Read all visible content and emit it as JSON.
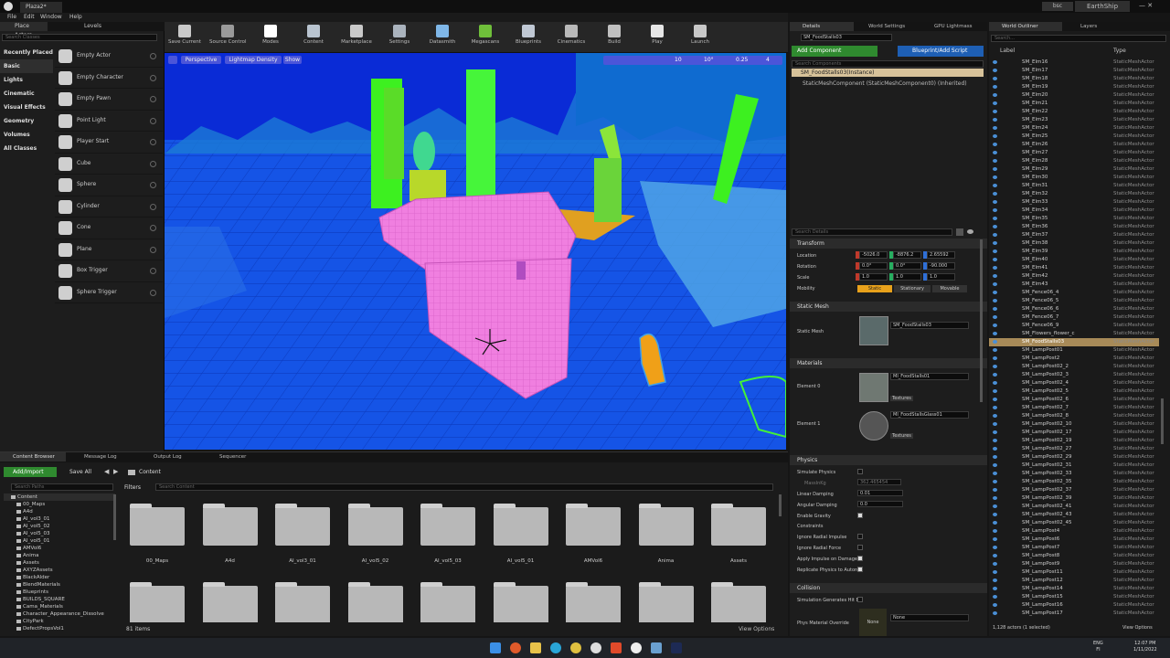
{
  "window": {
    "title": "Plaza2*",
    "right_title_1": "bsc",
    "right_title_2": "EarthShip"
  },
  "menu": [
    "File",
    "Edit",
    "Window",
    "Help"
  ],
  "toolbar": [
    {
      "label": "Save Current",
      "icon": "save-icon",
      "color": "#c9c9c9"
    },
    {
      "label": "Source Control",
      "icon": "source-control-icon",
      "color": "#9a9a9a"
    },
    {
      "label": "Modes",
      "icon": "modes-icon",
      "color": "#ffffff"
    },
    {
      "label": "Content",
      "icon": "content-icon",
      "color": "#b9c4d0"
    },
    {
      "label": "Marketplace",
      "icon": "marketplace-icon",
      "color": "#c9c9c9"
    },
    {
      "label": "Settings",
      "icon": "settings-icon",
      "color": "#aab3bd"
    },
    {
      "label": "Datasmith",
      "icon": "datasmith-icon",
      "color": "#7fb7e8"
    },
    {
      "label": "Megascans",
      "icon": "megascans-icon",
      "color": "#6fbf3a"
    },
    {
      "label": "Blueprints",
      "icon": "blueprints-icon",
      "color": "#c0c8d4"
    },
    {
      "label": "Cinematics",
      "icon": "cinematics-icon",
      "color": "#b9b9b9"
    },
    {
      "label": "Build",
      "icon": "build-icon",
      "color": "#c0c0c0"
    },
    {
      "label": "Play",
      "icon": "play-icon",
      "color": "#e6e6e6"
    },
    {
      "label": "Launch",
      "icon": "launch-icon",
      "color": "#c8c8c8"
    }
  ],
  "modes": {
    "tabs": [
      "Place Actors",
      "Levels"
    ],
    "search_placeholder": "Search Classes",
    "categories": [
      "Recently Placed",
      "Basic",
      "Lights",
      "Cinematic",
      "Visual Effects",
      "Geometry",
      "Volumes",
      "All Classes"
    ],
    "active_category": "Basic",
    "items": [
      "Empty Actor",
      "Empty Character",
      "Empty Pawn",
      "Point Light",
      "Player Start",
      "Cube",
      "Sphere",
      "Cylinder",
      "Cone",
      "Plane",
      "Box Trigger",
      "Sphere Trigger"
    ]
  },
  "viewport": {
    "perspective": "Perspective",
    "view_mode": "Lightmap Density",
    "show": "Show",
    "grid": "10",
    "angle": "10°",
    "scale": "0.25",
    "camera": "4"
  },
  "bottom": {
    "tabs": [
      "Content Browser",
      "Message Log",
      "Output Log",
      "Sequencer"
    ],
    "add_import": "Add/Import",
    "save_all": "Save All",
    "path": "Content",
    "search_paths": "Search Paths",
    "filters": "Filters",
    "search_content": "Search Content",
    "tree": [
      "Content",
      "00_Maps",
      "A4d",
      "AI_vol3_01",
      "AI_vol5_02",
      "AI_vol5_03",
      "AI_vol5_01",
      "AMVol6",
      "Anima",
      "Assets",
      "AXYZAssets",
      "BlackAlder",
      "BlendMaterials",
      "Blueprints",
      "BUILDS_SQUARE",
      "Cama_Materials",
      "Character_Appearance_Dissolve",
      "CityPark",
      "DefectPropsVol1"
    ],
    "folders": [
      "00_Maps",
      "A4d",
      "AI_vol3_01",
      "AI_vol5_02",
      "AI_vol5_03",
      "AI_vol5_01",
      "AMVol6",
      "Anima",
      "Assets"
    ],
    "item_count": "81 items",
    "view_options": "View Options"
  },
  "details": {
    "tabs": [
      "Details",
      "World Settings",
      "GPU Lightmass"
    ],
    "actor_name": "SM_FoodStalls03",
    "add_component": "Add Component",
    "blueprint_script": "Blueprint/Add Script",
    "search_components": "Search Components",
    "instance": "SM_FoodStalls03(Instance)",
    "component": "StaticMeshComponent (StaticMeshComponent0) (Inherited)",
    "search_details": "Search Details",
    "transform": {
      "header": "Transform",
      "location_label": "Location",
      "rotation_label": "Rotation",
      "scale_label": "Scale",
      "mobility_label": "Mobility",
      "location": [
        "-5026.0",
        "-8876.2",
        "2.65592"
      ],
      "rotation": [
        "0.0°",
        "0.0°",
        "-90.000"
      ],
      "scale": [
        "1.0",
        "1.0",
        "1.0"
      ],
      "mobility": [
        "Static",
        "Stationary",
        "Movable"
      ]
    },
    "static_mesh": {
      "header": "Static Mesh",
      "label": "Static Mesh",
      "value": "SM_FoodStalls03"
    },
    "materials": {
      "header": "Materials",
      "element0": "Element 0",
      "mat0": "MI_FoodStalls01",
      "element1": "Element 1",
      "mat1": "MI_FoodStallsGlass01",
      "textures": "Textures"
    },
    "physics": {
      "header": "Physics",
      "simulate": "Simulate Physics",
      "mass_label": "MassInKg",
      "mass": "362.465454",
      "linear_label": "Linear Damping",
      "linear": "0.01",
      "angular_label": "Angular Damping",
      "angular": "0.0",
      "gravity": "Enable Gravity",
      "constraints": "Constraints",
      "ignore_impulse": "Ignore Radial Impulse",
      "ignore_force": "Ignore Radial Force",
      "apply_impulse": "Apply Impulse on Damage",
      "replicate": "Replicate Physics to Auton"
    },
    "collision": {
      "header": "Collision",
      "sim_hit": "Simulation Generates Hit E",
      "phys_material": "Phys Material Override",
      "none_thumb": "None",
      "none": "None"
    }
  },
  "outliner": {
    "tabs": [
      "World Outliner",
      "Layers"
    ],
    "search_placeholder": "Search...",
    "col_label": "Label",
    "col_type": "Type",
    "rows": [
      [
        "SM_Elm16",
        "StaticMeshActor"
      ],
      [
        "SM_Elm17",
        "StaticMeshActor"
      ],
      [
        "SM_Elm18",
        "StaticMeshActor"
      ],
      [
        "SM_Elm19",
        "StaticMeshActor"
      ],
      [
        "SM_Elm20",
        "StaticMeshActor"
      ],
      [
        "SM_Elm21",
        "StaticMeshActor"
      ],
      [
        "SM_Elm22",
        "StaticMeshActor"
      ],
      [
        "SM_Elm23",
        "StaticMeshActor"
      ],
      [
        "SM_Elm24",
        "StaticMeshActor"
      ],
      [
        "SM_Elm25",
        "StaticMeshActor"
      ],
      [
        "SM_Elm26",
        "StaticMeshActor"
      ],
      [
        "SM_Elm27",
        "StaticMeshActor"
      ],
      [
        "SM_Elm28",
        "StaticMeshActor"
      ],
      [
        "SM_Elm29",
        "StaticMeshActor"
      ],
      [
        "SM_Elm30",
        "StaticMeshActor"
      ],
      [
        "SM_Elm31",
        "StaticMeshActor"
      ],
      [
        "SM_Elm32",
        "StaticMeshActor"
      ],
      [
        "SM_Elm33",
        "StaticMeshActor"
      ],
      [
        "SM_Elm34",
        "StaticMeshActor"
      ],
      [
        "SM_Elm35",
        "StaticMeshActor"
      ],
      [
        "SM_Elm36",
        "StaticMeshActor"
      ],
      [
        "SM_Elm37",
        "StaticMeshActor"
      ],
      [
        "SM_Elm38",
        "StaticMeshActor"
      ],
      [
        "SM_Elm39",
        "StaticMeshActor"
      ],
      [
        "SM_Elm40",
        "StaticMeshActor"
      ],
      [
        "SM_Elm41",
        "StaticMeshActor"
      ],
      [
        "SM_Elm42",
        "StaticMeshActor"
      ],
      [
        "SM_Elm43",
        "StaticMeshActor"
      ],
      [
        "SM_Fence06_4",
        "StaticMeshActor"
      ],
      [
        "SM_Fence06_5",
        "StaticMeshActor"
      ],
      [
        "SM_Fence06_6",
        "StaticMeshActor"
      ],
      [
        "SM_Fence06_7",
        "StaticMeshActor"
      ],
      [
        "SM_Fence06_9",
        "StaticMeshActor"
      ],
      [
        "SM_Flowers_flower_c",
        "StaticMeshActor"
      ],
      [
        "SM_FoodStalls03",
        "StaticMeshActor"
      ],
      [
        "SM_LampPost01",
        "StaticMeshActor"
      ],
      [
        "SM_LampPost2",
        "StaticMeshActor"
      ],
      [
        "SM_LampPost02_2",
        "StaticMeshActor"
      ],
      [
        "SM_LampPost02_3",
        "StaticMeshActor"
      ],
      [
        "SM_LampPost02_4",
        "StaticMeshActor"
      ],
      [
        "SM_LampPost02_5",
        "StaticMeshActor"
      ],
      [
        "SM_LampPost02_6",
        "StaticMeshActor"
      ],
      [
        "SM_LampPost02_7",
        "StaticMeshActor"
      ],
      [
        "SM_LampPost02_8",
        "StaticMeshActor"
      ],
      [
        "SM_LampPost02_10",
        "StaticMeshActor"
      ],
      [
        "SM_LampPost02_17",
        "StaticMeshActor"
      ],
      [
        "SM_LampPost02_19",
        "StaticMeshActor"
      ],
      [
        "SM_LampPost02_27",
        "StaticMeshActor"
      ],
      [
        "SM_LampPost02_29",
        "StaticMeshActor"
      ],
      [
        "SM_LampPost02_31",
        "StaticMeshActor"
      ],
      [
        "SM_LampPost02_33",
        "StaticMeshActor"
      ],
      [
        "SM_LampPost02_35",
        "StaticMeshActor"
      ],
      [
        "SM_LampPost02_37",
        "StaticMeshActor"
      ],
      [
        "SM_LampPost02_39",
        "StaticMeshActor"
      ],
      [
        "SM_LampPost02_41",
        "StaticMeshActor"
      ],
      [
        "SM_LampPost02_43",
        "StaticMeshActor"
      ],
      [
        "SM_LampPost02_45",
        "StaticMeshActor"
      ],
      [
        "SM_LampPost4",
        "StaticMeshActor"
      ],
      [
        "SM_LampPost6",
        "StaticMeshActor"
      ],
      [
        "SM_LampPost7",
        "StaticMeshActor"
      ],
      [
        "SM_LampPost8",
        "StaticMeshActor"
      ],
      [
        "SM_LampPost9",
        "StaticMeshActor"
      ],
      [
        "SM_LampPost11",
        "StaticMeshActor"
      ],
      [
        "SM_LampPost12",
        "StaticMeshActor"
      ],
      [
        "SM_LampPost14",
        "StaticMeshActor"
      ],
      [
        "SM_LampPost15",
        "StaticMeshActor"
      ],
      [
        "SM_LampPost16",
        "StaticMeshActor"
      ],
      [
        "SM_LampPost17",
        "StaticMeshActor"
      ]
    ],
    "selected": "SM_FoodStalls03",
    "status": "1,128 actors (1 selected)",
    "view_options": "View Options"
  },
  "taskbar": {
    "lang": "ENG",
    "region": "FI",
    "time": "12:07 PM",
    "date": "1/11/2022"
  }
}
